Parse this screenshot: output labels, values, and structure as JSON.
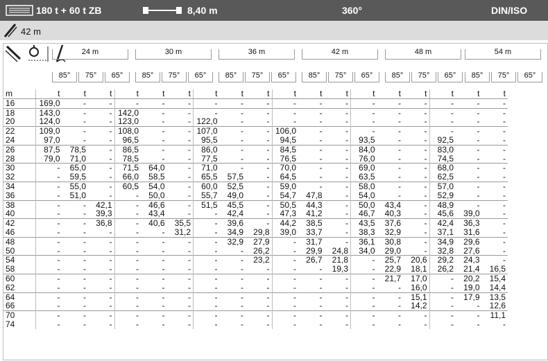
{
  "header": {
    "capacity": "180 t + 60 t ZB",
    "width": "8,40 m",
    "rotation": "360°",
    "standard": "DIN/ISO"
  },
  "subheader": {
    "height": "42 m"
  },
  "boom_lengths": [
    "24 m",
    "30 m",
    "36 m",
    "42 m",
    "48 m",
    "54 m"
  ],
  "angles": [
    "85°",
    "75°",
    "65°"
  ],
  "units": {
    "radius": "m",
    "load": "t"
  },
  "rows": [
    {
      "r": "16",
      "v": [
        "169,0",
        "-",
        "-",
        "-",
        "-",
        "-",
        "-",
        "-",
        "-",
        "-",
        "-",
        "-",
        "-",
        "-",
        "-",
        "-",
        "-",
        "-"
      ]
    },
    {
      "r": "18",
      "v": [
        "143,0",
        "-",
        "-",
        "142,0",
        "-",
        "-",
        "-",
        "-",
        "-",
        "-",
        "-",
        "-",
        "-",
        "-",
        "-",
        "-",
        "-",
        "-"
      ]
    },
    {
      "r": "20",
      "v": [
        "124,0",
        "-",
        "-",
        "123,0",
        "-",
        "-",
        "122,0",
        "-",
        "-",
        "-",
        "-",
        "-",
        "-",
        "-",
        "-",
        "-",
        "-",
        "-"
      ]
    },
    {
      "r": "22",
      "v": [
        "109,0",
        "-",
        "-",
        "108,0",
        "-",
        "-",
        "107,0",
        "-",
        "-",
        "106,0",
        "-",
        "-",
        "-",
        "-",
        "-",
        "-",
        "-",
        "-"
      ]
    },
    {
      "r": "24",
      "v": [
        "97,0",
        "-",
        "-",
        "96,5",
        "-",
        "-",
        "95,5",
        "-",
        "-",
        "94,5",
        "-",
        "-",
        "93,5",
        "-",
        "-",
        "92,5",
        "-",
        "-"
      ]
    },
    {
      "r": "26",
      "v": [
        "87,5",
        "78,5",
        "-",
        "86,5",
        "-",
        "-",
        "86,0",
        "-",
        "-",
        "84,5",
        "-",
        "-",
        "84,0",
        "-",
        "-",
        "83,0",
        "-",
        "-"
      ]
    },
    {
      "r": "28",
      "v": [
        "79,0",
        "71,0",
        "-",
        "78,5",
        "-",
        "-",
        "77,5",
        "-",
        "-",
        "76,5",
        "-",
        "-",
        "76,0",
        "-",
        "-",
        "74,5",
        "-",
        "-"
      ]
    },
    {
      "r": "30",
      "v": [
        "-",
        "65,0",
        "-",
        "71,5",
        "64,0",
        "-",
        "71,0",
        "-",
        "-",
        "70,0",
        "-",
        "-",
        "69,0",
        "-",
        "-",
        "68,0",
        "-",
        "-"
      ]
    },
    {
      "r": "32",
      "v": [
        "-",
        "59,5",
        "-",
        "66,0",
        "58,5",
        "-",
        "65,5",
        "57,5",
        "-",
        "64,5",
        "-",
        "-",
        "63,5",
        "-",
        "-",
        "62,5",
        "-",
        "-"
      ]
    },
    {
      "r": "34",
      "v": [
        "-",
        "55,0",
        "-",
        "60,5",
        "54,0",
        "-",
        "60,0",
        "52,5",
        "-",
        "59,0",
        "-",
        "-",
        "58,0",
        "-",
        "-",
        "57,0",
        "-",
        "-"
      ]
    },
    {
      "r": "36",
      "v": [
        "-",
        "51,0",
        "-",
        "-",
        "50,0",
        "-",
        "55,7",
        "49,0",
        "-",
        "54,7",
        "47,8",
        "-",
        "54,0",
        "-",
        "-",
        "52,9",
        "-",
        "-"
      ]
    },
    {
      "r": "38",
      "v": [
        "-",
        "-",
        "42,1",
        "-",
        "46,6",
        "-",
        "51,5",
        "45,5",
        "-",
        "50,5",
        "44,3",
        "-",
        "50,0",
        "43,4",
        "-",
        "48,9",
        "-",
        "-"
      ]
    },
    {
      "r": "40",
      "v": [
        "-",
        "-",
        "39,3",
        "-",
        "43,4",
        "-",
        "-",
        "42,4",
        "-",
        "47,3",
        "41,2",
        "-",
        "46,7",
        "40,3",
        "-",
        "45,6",
        "39,0",
        "-"
      ]
    },
    {
      "r": "42",
      "v": [
        "-",
        "-",
        "36,8",
        "-",
        "40,6",
        "35,5",
        "-",
        "39,6",
        "-",
        "44,2",
        "38,5",
        "-",
        "43,5",
        "37,6",
        "-",
        "42,4",
        "36,3",
        "-"
      ]
    },
    {
      "r": "46",
      "v": [
        "-",
        "-",
        "-",
        "-",
        "-",
        "31,2",
        "-",
        "34,9",
        "29,8",
        "39,0",
        "33,7",
        "-",
        "38,3",
        "32,9",
        "-",
        "37,1",
        "31,6",
        "-"
      ]
    },
    {
      "r": "48",
      "v": [
        "-",
        "-",
        "-",
        "-",
        "-",
        "-",
        "-",
        "32,9",
        "27,9",
        "-",
        "31,7",
        "-",
        "36,1",
        "30,8",
        "-",
        "34,9",
        "29,6",
        "-"
      ]
    },
    {
      "r": "50",
      "v": [
        "-",
        "-",
        "-",
        "-",
        "-",
        "-",
        "-",
        "-",
        "26,2",
        "-",
        "29,9",
        "24,8",
        "34,0",
        "29,0",
        "-",
        "32,8",
        "27,6",
        "-"
      ]
    },
    {
      "r": "54",
      "v": [
        "-",
        "-",
        "-",
        "-",
        "-",
        "-",
        "-",
        "-",
        "23,2",
        "-",
        "26,7",
        "21,8",
        "-",
        "25,7",
        "20,6",
        "29,2",
        "24,3",
        "-"
      ]
    },
    {
      "r": "58",
      "v": [
        "-",
        "-",
        "-",
        "-",
        "-",
        "-",
        "-",
        "-",
        "-",
        "-",
        "-",
        "19,3",
        "-",
        "22,9",
        "18,1",
        "26,2",
        "21,4",
        "16,5"
      ]
    },
    {
      "r": "60",
      "v": [
        "-",
        "-",
        "-",
        "-",
        "-",
        "-",
        "-",
        "-",
        "-",
        "-",
        "-",
        "-",
        "-",
        "21,7",
        "17,0",
        "-",
        "20,2",
        "15,4"
      ]
    },
    {
      "r": "62",
      "v": [
        "-",
        "-",
        "-",
        "-",
        "-",
        "-",
        "-",
        "-",
        "-",
        "-",
        "-",
        "-",
        "-",
        "-",
        "16,0",
        "-",
        "19,0",
        "14,4"
      ]
    },
    {
      "r": "64",
      "v": [
        "-",
        "-",
        "-",
        "-",
        "-",
        "-",
        "-",
        "-",
        "-",
        "-",
        "-",
        "-",
        "-",
        "-",
        "15,1",
        "-",
        "17,9",
        "13,5"
      ]
    },
    {
      "r": "66",
      "v": [
        "-",
        "-",
        "-",
        "-",
        "-",
        "-",
        "-",
        "-",
        "-",
        "-",
        "-",
        "-",
        "-",
        "-",
        "14,2",
        "-",
        "-",
        "12,6"
      ]
    },
    {
      "r": "70",
      "v": [
        "-",
        "-",
        "-",
        "-",
        "-",
        "-",
        "-",
        "-",
        "-",
        "-",
        "-",
        "-",
        "-",
        "-",
        "-",
        "-",
        "-",
        "11,1"
      ]
    },
    {
      "r": "74",
      "v": [
        "-",
        "-",
        "-",
        "-",
        "-",
        "-",
        "-",
        "-",
        "-",
        "-",
        "-",
        "-",
        "-",
        "-",
        "-",
        "-",
        "-",
        "-"
      ]
    }
  ]
}
